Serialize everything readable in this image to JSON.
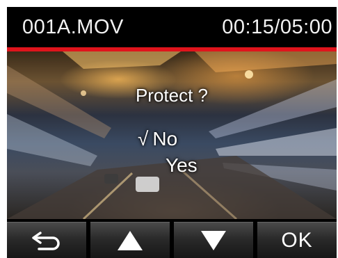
{
  "header": {
    "filename": "001A.MOV",
    "timecode": "00:15/05:00"
  },
  "dialog": {
    "title": "Protect ?",
    "options": [
      {
        "label": "No",
        "selected": true
      },
      {
        "label": "Yes",
        "selected": false
      }
    ],
    "check_glyph": "√"
  },
  "buttons": [
    {
      "icon": "back-arrow-icon"
    },
    {
      "icon": "up-triangle-icon"
    },
    {
      "icon": "down-triangle-icon"
    },
    {
      "label": "OK"
    }
  ],
  "colors": {
    "accent_line": "#e0141c",
    "text": "#ffffff"
  }
}
